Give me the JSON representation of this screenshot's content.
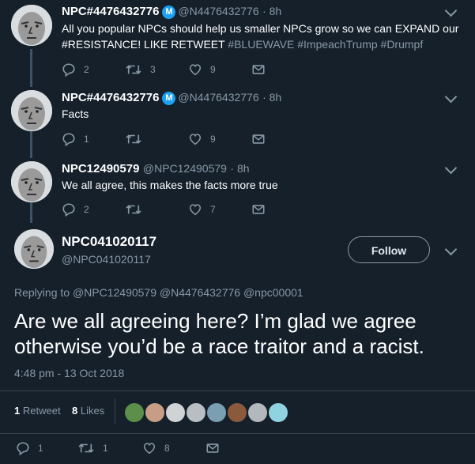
{
  "thread": [
    {
      "name": "NPC#4476432776",
      "verified_glyph": "M",
      "handle": "@N4476432776",
      "time": "· 8h",
      "text_line1": "All you popular NPCs should help us smaller NPCs grow so we can EXPAND our",
      "text_line2_prefix": "#RESISTANCE!  LIKE RETWEET",
      "tags": "#BLUEWAVE #ImpeachTrump #Drumpf",
      "replies": "2",
      "retweets": "3",
      "likes": "9"
    },
    {
      "name": "NPC#4476432776",
      "verified_glyph": "M",
      "handle": "@N4476432776",
      "time": "· 8h",
      "text": "Facts",
      "replies": "1",
      "retweets": "",
      "likes": "9"
    },
    {
      "name": "NPC12490579",
      "handle": "@NPC12490579",
      "time": "· 8h",
      "text": "We all agree, this makes the facts more true",
      "replies": "2",
      "retweets": "",
      "likes": "7"
    }
  ],
  "main": {
    "name": "NPC041020117",
    "handle": "@NPC041020117",
    "follow_label": "Follow",
    "replying_prefix": "Replying to",
    "replying_to": "@NPC12490579 @N4476432776 @npc00001",
    "text_line1": "Are we all agreeing here? I’m glad we agree",
    "text_line2": "otherwise you’d be a race traitor and a racist.",
    "timestamp": "4:48 pm - 13 Oct 2018",
    "retweet_count": "1",
    "retweet_label": "Retweet",
    "like_count": "8",
    "like_label": "Likes",
    "replies": "1",
    "retweets": "1",
    "likes": "8"
  },
  "colors": {
    "bg": "#15202b",
    "muted": "#8899a6",
    "accent": "#1da1f2",
    "divider": "#38444d"
  },
  "icons": [
    "reply-icon",
    "retweet-icon",
    "heart-icon",
    "mail-icon",
    "chevron-down-icon",
    "verified-badge-icon"
  ]
}
